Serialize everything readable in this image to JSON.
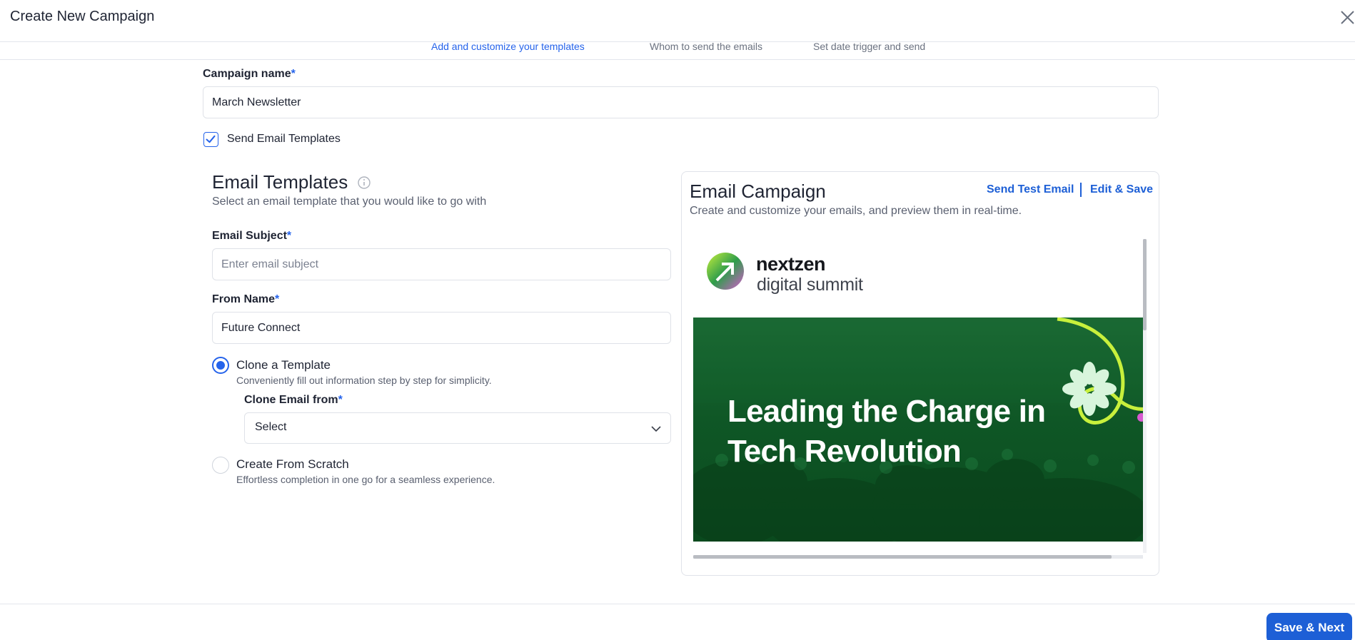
{
  "header": {
    "title": "Create New Campaign"
  },
  "steps": [
    {
      "description": "Add and customize your templates",
      "active": true
    },
    {
      "description": "Whom to send the emails",
      "active": false
    },
    {
      "description": "Set date trigger and send",
      "active": false
    }
  ],
  "form": {
    "campaign_name_label": "Campaign name",
    "required_mark": "*",
    "campaign_name_value": "March Newsletter",
    "send_templates_checked": true,
    "send_templates_label": "Send Email Templates",
    "templates_title": "Email Templates",
    "templates_subtitle": "Select an email template that you would like to go with",
    "subject_label": "Email Subject",
    "subject_value": "",
    "subject_placeholder": "Enter email subject",
    "from_label": "From Name",
    "from_value": "Future Connect",
    "options": [
      {
        "label": "Clone a Template",
        "description": "Conveniently fill out information step by step for simplicity.",
        "selected": true
      },
      {
        "label": "Create From Scratch",
        "description": "Effortless completion in one go for a seamless experience.",
        "selected": false
      }
    ],
    "clone_from_label": "Clone Email from",
    "clone_from_value": "Select"
  },
  "preview": {
    "title": "Email Campaign",
    "subtitle": "Create and customize your emails, and preview them in real-time.",
    "send_test_label": "Send Test Email",
    "edit_save_label": "Edit & Save",
    "logo_name": "nextzen",
    "logo_tagline": "digital summit",
    "banner_headline": "Leading the Charge in Tech Revolution"
  },
  "footer": {
    "save_next_label": "Save & Next"
  },
  "colors": {
    "accent": "#1d5fd6",
    "banner_green": "#0f5726",
    "lime": "#c8f03c"
  },
  "icons": {
    "close": "close-icon",
    "check": "checkmark-icon",
    "info": "info-icon",
    "chevron": "chevron-down-icon",
    "logo": "nextzen-logo-icon"
  }
}
